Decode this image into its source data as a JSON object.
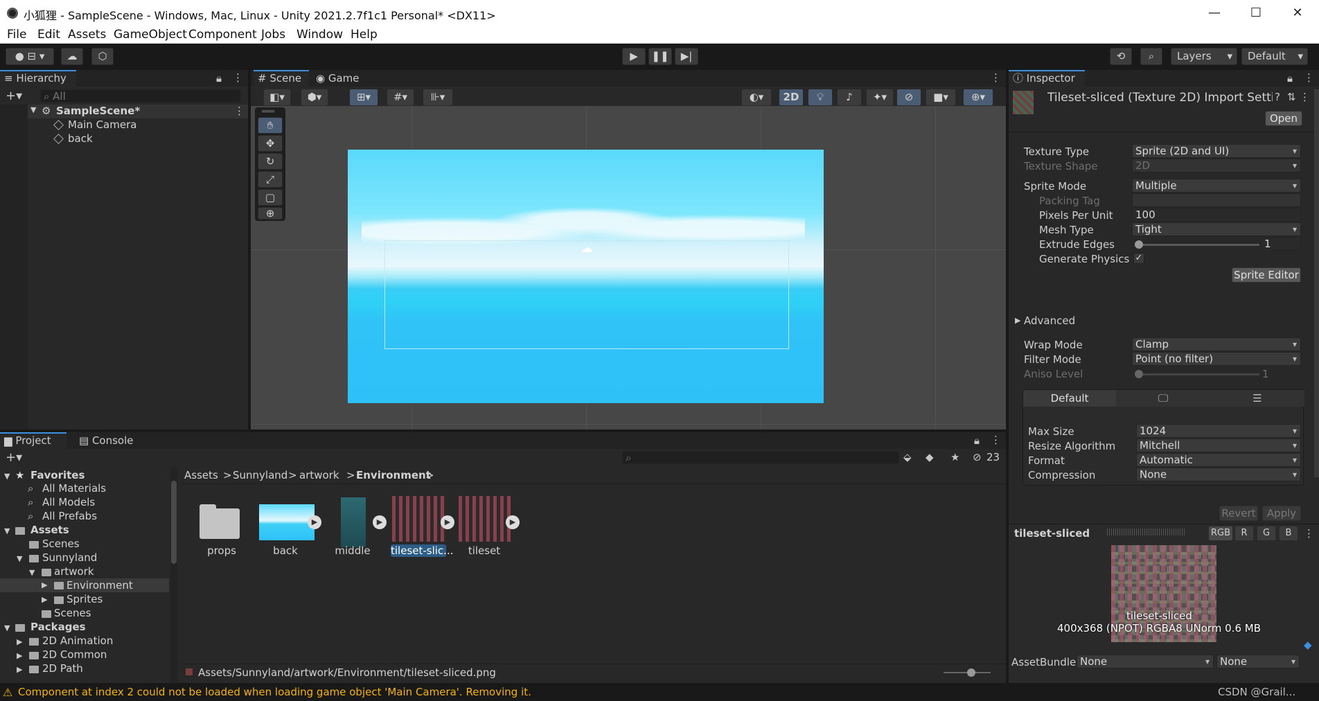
{
  "window": {
    "title": "小狐狸 - SampleScene - Windows, Mac, Linux - Unity 2021.2.7f1c1 Personal* <DX11>",
    "minimize": "—",
    "maximize": "☐",
    "close": "✕"
  },
  "menu": [
    "File",
    "Edit",
    "Assets",
    "GameObject",
    "Component",
    "Jobs",
    "Window",
    "Help"
  ],
  "toolbar": {
    "layers_label": "Layers",
    "layout_label": "Default"
  },
  "hierarchy": {
    "tab": "Hierarchy",
    "search_placeholder": "All",
    "scene": "SampleScene*",
    "items": [
      "Main Camera",
      "back"
    ]
  },
  "scene_view": {
    "tabs": [
      "Scene",
      "Game"
    ],
    "mode_2d": "2D"
  },
  "inspector": {
    "tab": "Inspector",
    "asset_title": "Tileset-sliced (Texture 2D) Import Setti",
    "open_button": "Open",
    "texture_type_label": "Texture Type",
    "texture_type_value": "Sprite (2D and UI)",
    "texture_shape_label": "Texture Shape",
    "texture_shape_value": "2D",
    "sprite_mode_label": "Sprite Mode",
    "sprite_mode_value": "Multiple",
    "packing_tag_label": "Packing Tag",
    "ppu_label": "Pixels Per Unit",
    "ppu_value": "100",
    "mesh_type_label": "Mesh Type",
    "mesh_type_value": "Tight",
    "extrude_label": "Extrude Edges",
    "extrude_value": "1",
    "physics_label": "Generate Physics",
    "sprite_editor_button": "Sprite Editor",
    "advanced_label": "Advanced",
    "wrap_mode_label": "Wrap Mode",
    "wrap_mode_value": "Clamp",
    "filter_mode_label": "Filter Mode",
    "filter_mode_value": "Point (no filter)",
    "aniso_label": "Aniso Level",
    "aniso_value": "1",
    "platform_default": "Default",
    "max_size_label": "Max Size",
    "max_size_value": "1024",
    "resize_label": "Resize Algorithm",
    "resize_value": "Mitchell",
    "format_label": "Format",
    "format_value": "Automatic",
    "compression_label": "Compression",
    "compression_value": "None",
    "revert_button": "Revert",
    "apply_button": "Apply"
  },
  "preview": {
    "name": "tileset-sliced",
    "channels": [
      "RGB",
      "R",
      "G",
      "B"
    ],
    "overlay_name": "tileset-sliced",
    "info": "400x368 (NPOT)  RGBA8 UNorm   0.6 MB",
    "assetbundle_label": "AssetBundle",
    "assetbundle_value": "None",
    "variant_value": "None"
  },
  "project": {
    "tabs": [
      "Project",
      "Console"
    ],
    "hidden_count": "23",
    "favorites_label": "Favorites",
    "favorites": [
      "All Materials",
      "All Models",
      "All Prefabs"
    ],
    "assets_label": "Assets",
    "tree": [
      "Scenes",
      "Sunnyland",
      "artwork",
      "Environment",
      "Sprites",
      "Scenes"
    ],
    "packages_label": "Packages",
    "packages": [
      "2D Animation",
      "2D Common",
      "2D Path"
    ],
    "breadcrumb": [
      "Assets",
      "Sunnyland",
      "artwork",
      "Environment"
    ],
    "files": [
      "props",
      "back",
      "middle",
      "tileset-slic...",
      "tileset"
    ],
    "status_path": "Assets/Sunnyland/artwork/Environment/tileset-sliced.png"
  },
  "statusbar": {
    "message": "Component at index 2 could not be loaded when loading game object 'Main Camera'. Removing it.",
    "watermark": "CSDN @Grail..."
  },
  "colors": {
    "accent": "#3d8fe0",
    "sky": "#4dd3fb",
    "sea": "#2cc0f8",
    "warning": "#f5b400"
  }
}
